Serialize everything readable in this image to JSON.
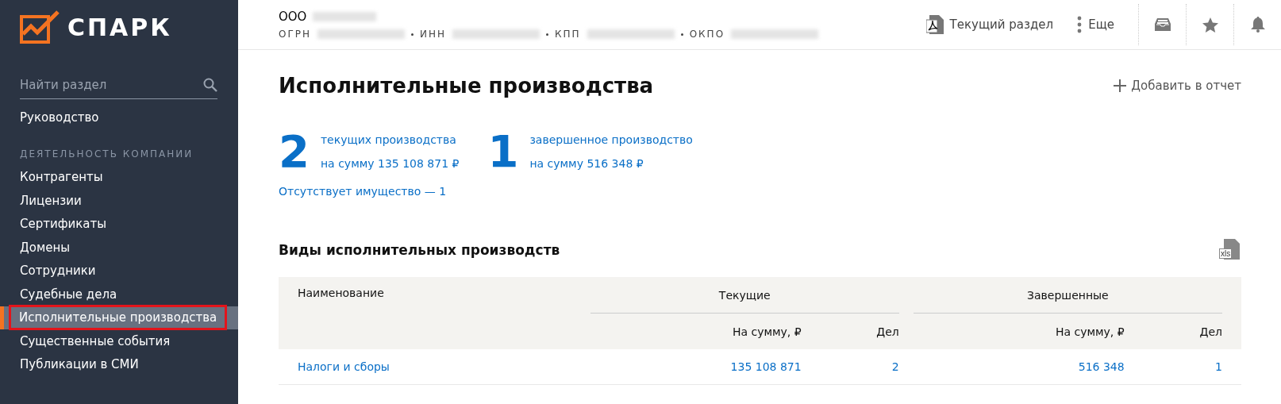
{
  "sidebar": {
    "logo": "СПАРК",
    "search": {
      "placeholder": "Найти раздел"
    },
    "items": [
      {
        "label": "Руководство",
        "kind": "item",
        "selected": false
      },
      {
        "label": "ДЕЯТЕЛЬНОСТЬ КОМПАНИИ",
        "kind": "heading"
      },
      {
        "label": "Контрагенты",
        "kind": "item",
        "selected": false
      },
      {
        "label": "Лицензии",
        "kind": "item",
        "selected": false
      },
      {
        "label": "Сертификаты",
        "kind": "item",
        "selected": false
      },
      {
        "label": "Домены",
        "kind": "item",
        "selected": false
      },
      {
        "label": "Сотрудники",
        "kind": "item",
        "selected": false
      },
      {
        "label": "Судебные дела",
        "kind": "item",
        "selected": false
      },
      {
        "label": "Исполнительные производства",
        "kind": "item",
        "selected": true
      },
      {
        "label": "Существенные события",
        "kind": "item",
        "selected": false
      },
      {
        "label": "Публикации в СМИ",
        "kind": "item",
        "selected": false
      }
    ]
  },
  "header": {
    "company_prefix": "ООО",
    "ids": [
      "ОГРН",
      "ИНН",
      "КПП",
      "ОКПО"
    ],
    "actions": [
      {
        "label": "Текущий раздел",
        "kind": "pdf"
      },
      {
        "label": "Еще",
        "kind": "more"
      }
    ],
    "icons": [
      {
        "kind": "inbox"
      },
      {
        "kind": "star"
      },
      {
        "kind": "bell"
      }
    ]
  },
  "page": {
    "title": "Исполнительные производства",
    "add_to_report": "Добавить в отчет",
    "stats": [
      {
        "count": "2",
        "line1": "текущих производства",
        "line2": "на сумму 135 108 871 ₽"
      },
      {
        "count": "1",
        "line1": "завершенное производство",
        "line2": "на сумму 516 348 ₽"
      }
    ],
    "no_property": "Отсутствует имущество — 1",
    "section_title": "Виды исполнительных производств",
    "export_label": "xls",
    "table": {
      "name_column": "Наименование",
      "groups": [
        "Текущие",
        "Завершенные"
      ],
      "sub_columns": [
        "На сумму, ₽",
        "Дел",
        "На сумму, ₽",
        "Дел"
      ],
      "rows": [
        {
          "name": "Налоги и сборы",
          "values": [
            "135 108 871",
            "2",
            "516 348",
            "1"
          ]
        }
      ]
    }
  }
}
